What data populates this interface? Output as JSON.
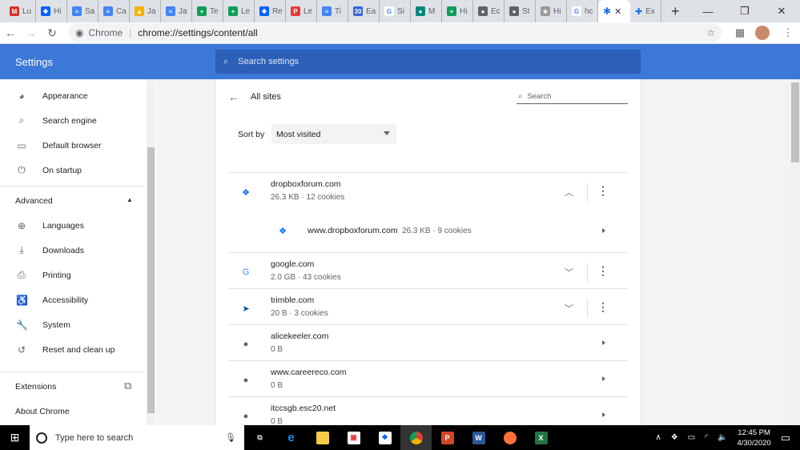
{
  "tabs": [
    {
      "label": "Lu",
      "icon": "gmail-icon",
      "color": "#d93025",
      "glyph": "M"
    },
    {
      "label": "Hi",
      "icon": "dropbox-icon",
      "color": "#0061fe",
      "glyph": "❖"
    },
    {
      "label": "Sa",
      "icon": "docs-icon",
      "color": "#4285f4",
      "glyph": "≡"
    },
    {
      "label": "Ca",
      "icon": "docs-icon",
      "color": "#4285f4",
      "glyph": "≡"
    },
    {
      "label": "Ja",
      "icon": "drive-icon",
      "color": "#f4b400",
      "glyph": "▲"
    },
    {
      "label": "Ja",
      "icon": "docs-icon",
      "color": "#4285f4",
      "glyph": "≡"
    },
    {
      "label": "Te",
      "icon": "sheets-icon",
      "color": "#0f9d58",
      "glyph": "+"
    },
    {
      "label": "Le",
      "icon": "sheets-icon",
      "color": "#0f9d58",
      "glyph": "+"
    },
    {
      "label": "Re",
      "icon": "dropbox-icon",
      "color": "#0061fe",
      "glyph": "❖"
    },
    {
      "label": "Le",
      "icon": "pdf-icon",
      "color": "#e53935",
      "glyph": "P"
    },
    {
      "label": "Ti",
      "icon": "docs-icon",
      "color": "#4285f4",
      "glyph": "≡"
    },
    {
      "label": "Ea",
      "icon": "calendar-icon",
      "color": "#3367d6",
      "glyph": "30"
    },
    {
      "label": "Si",
      "icon": "google-icon",
      "color": "#ffffff",
      "glyph": "G"
    },
    {
      "label": "M",
      "icon": "chat-icon",
      "color": "#00897b",
      "glyph": "●"
    },
    {
      "label": "Hi",
      "icon": "sheets-icon",
      "color": "#0f9d58",
      "glyph": "+"
    },
    {
      "label": "Ec",
      "icon": "globe-icon",
      "color": "#5f6368",
      "glyph": "●"
    },
    {
      "label": "St",
      "icon": "globe-icon",
      "color": "#5f6368",
      "glyph": "●"
    },
    {
      "label": "Hi",
      "icon": "extension-icon",
      "color": "#999999",
      "glyph": "★"
    },
    {
      "label": "hc",
      "icon": "google-icon",
      "color": "#ffffff",
      "glyph": "G"
    }
  ],
  "active_tab": {
    "icon": "settings-gear-icon",
    "close": "✕"
  },
  "last_tab": {
    "label": "Ex",
    "icon": "puzzle-icon"
  },
  "address": {
    "origin": "Chrome",
    "url": "chrome://settings/content/all"
  },
  "header": {
    "title": "Settings",
    "search_placeholder": "Search settings"
  },
  "sidebar": {
    "items": [
      {
        "label": "Appearance",
        "icon": "palette-icon",
        "glyph": "◕"
      },
      {
        "label": "Search engine",
        "icon": "search-icon",
        "glyph": "⌕"
      },
      {
        "label": "Default browser",
        "icon": "browser-icon",
        "glyph": "▭"
      },
      {
        "label": "On startup",
        "icon": "power-icon",
        "glyph": "⏻"
      }
    ],
    "advanced_label": "Advanced",
    "advanced_items": [
      {
        "label": "Languages",
        "icon": "globe-icon",
        "glyph": "⊕"
      },
      {
        "label": "Downloads",
        "icon": "download-icon",
        "glyph": "⤓"
      },
      {
        "label": "Printing",
        "icon": "printer-icon",
        "glyph": "⎙"
      },
      {
        "label": "Accessibility",
        "icon": "accessibility-icon",
        "glyph": "♿"
      },
      {
        "label": "System",
        "icon": "wrench-icon",
        "glyph": "🔧"
      },
      {
        "label": "Reset and clean up",
        "icon": "restore-icon",
        "glyph": "↺"
      }
    ],
    "extensions_label": "Extensions",
    "about_label": "About Chrome"
  },
  "main": {
    "title": "All sites",
    "search_placeholder": "Search",
    "sort_label": "Sort by",
    "sort_value": "Most visited",
    "sites": [
      {
        "name": "dropboxforum.com",
        "detail": "26.3 KB · 12 cookies",
        "icon": "dropbox-icon",
        "expanded": true
      },
      {
        "name": "www.dropboxforum.com",
        "detail": "26.3 KB · 9 cookies",
        "icon": "dropbox-icon",
        "child": true
      },
      {
        "name": "google.com",
        "detail": "2.0 GB · 43 cookies",
        "icon": "google-icon",
        "expanded": false
      },
      {
        "name": "trimble.com",
        "detail": "20 B · 3 cookies",
        "icon": "trimble-icon",
        "expanded": false
      },
      {
        "name": "alicekeeler.com",
        "detail": "0 B",
        "icon": "globe-icon"
      },
      {
        "name": "www.careereco.com",
        "detail": "0 B",
        "icon": "globe-icon"
      },
      {
        "name": "itccsgb.esc20.net",
        "detail": "0 B",
        "icon": "globe-icon"
      }
    ]
  },
  "taskbar": {
    "search_placeholder": "Type here to search",
    "time": "12:45 PM",
    "date": "4/30/2020"
  }
}
